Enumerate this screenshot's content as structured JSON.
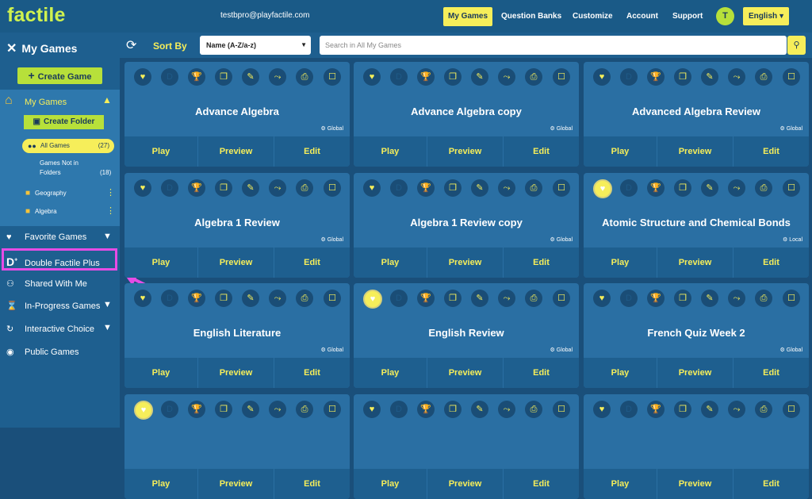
{
  "topbar": {
    "logo": "factile",
    "email": "testbpro@playfactile.com",
    "nav": [
      "My Games",
      "Question Banks",
      "Customize",
      "Account",
      "Support"
    ],
    "avatar": "T",
    "language": "English"
  },
  "sidebar": {
    "title": "My Games",
    "create_game": "Create Game",
    "my_games": "My Games",
    "create_folder": "Create Folder",
    "all_games": "All Games",
    "all_games_count": "(27)",
    "games_not_in_folders_1": "Games Not in",
    "games_not_in_folders_2": "Folders",
    "games_not_in_folders_count": "(18)",
    "folders": [
      "Geography",
      "Algebra"
    ],
    "items": [
      "Favorite Games",
      "Double Factile Plus",
      "Shared With Me",
      "In-Progress Games",
      "Interactive Choice",
      "Public Games"
    ]
  },
  "toolbar": {
    "sort_by": "Sort By",
    "sort_value": "Name (A-Z/a-z)",
    "search_placeholder": "Search in All My Games"
  },
  "card_actions": [
    "Play",
    "Preview",
    "Edit"
  ],
  "cards": [
    {
      "title": "Advance Algebra",
      "scope": "Global",
      "fav": false
    },
    {
      "title": "Advance Algebra copy",
      "scope": "Global",
      "fav": false
    },
    {
      "title": "Advanced Algebra Review",
      "scope": "Global",
      "fav": false
    },
    {
      "title": "Algebra 1 Review",
      "scope": "Global",
      "fav": false
    },
    {
      "title": "Algebra 1 Review copy",
      "scope": "Global",
      "fav": false
    },
    {
      "title": "Atomic Structure and Chemical Bonds",
      "scope": "Local",
      "fav": true
    },
    {
      "title": "English Literature",
      "scope": "Global",
      "fav": false
    },
    {
      "title": "English Review",
      "scope": "Global",
      "fav": true
    },
    {
      "title": "French Quiz Week 2",
      "scope": "Global",
      "fav": false
    },
    {
      "title": "",
      "scope": "",
      "fav": true
    },
    {
      "title": "",
      "scope": "",
      "fav": false
    },
    {
      "title": "",
      "scope": "",
      "fav": false
    }
  ],
  "icon_names": [
    "heart-icon",
    "double-d-icon",
    "trophy-icon",
    "copy-icon",
    "edit-icon",
    "share-icon",
    "print-icon",
    "select-checkbox"
  ]
}
